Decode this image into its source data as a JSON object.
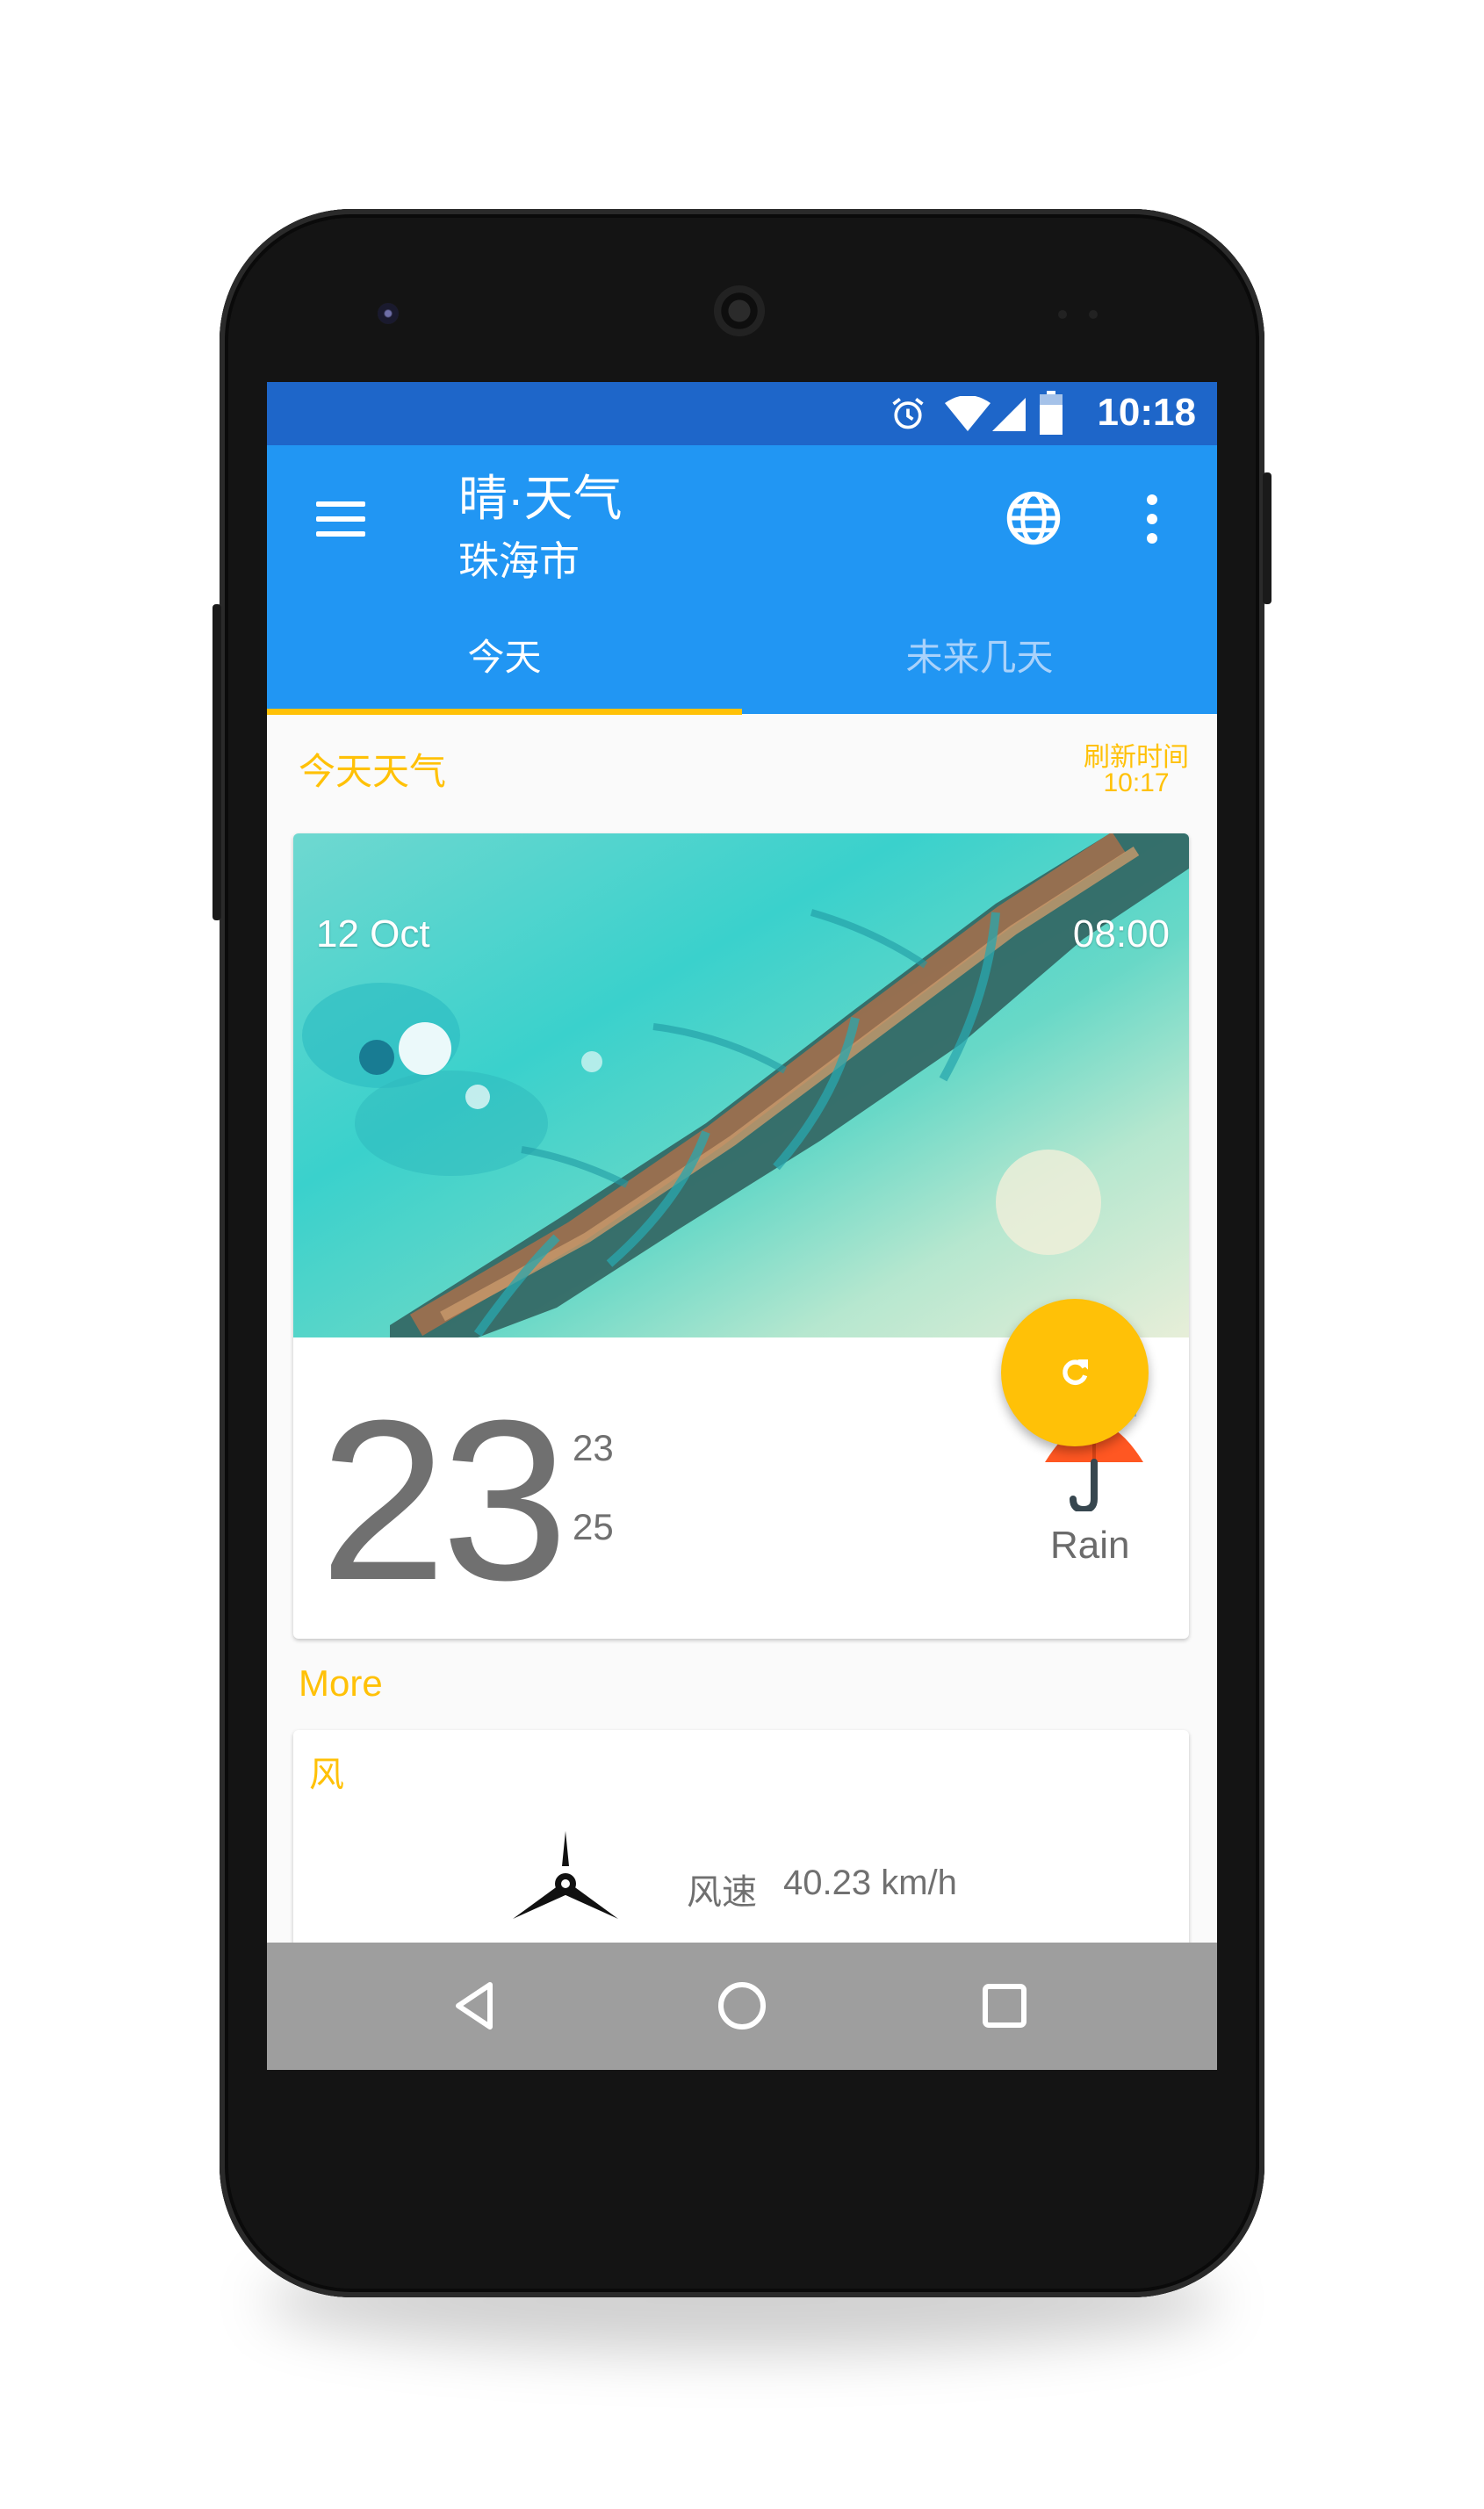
{
  "status_bar": {
    "time": "10:18",
    "icons": [
      "alarm-icon",
      "wifi-icon",
      "signal-icon",
      "battery-icon"
    ],
    "background": "#1e66c9"
  },
  "app_bar": {
    "title": "晴·天气",
    "subtitle": "珠海市",
    "background": "#2196f3",
    "icons": [
      "menu-icon",
      "globe-icon",
      "more-vert-icon"
    ]
  },
  "tabs": [
    {
      "label": "今天",
      "selected": true
    },
    {
      "label": "未来几天",
      "selected": false
    }
  ],
  "today_section": {
    "label": "今天天气",
    "refresh_label": "刷新时间",
    "refresh_time": "10:17"
  },
  "weather_card": {
    "date": "12 Oct",
    "time": "08:00",
    "temperature": "23",
    "temp_values": [
      "23",
      "25"
    ],
    "condition": "Rain",
    "condition_icon": "umbrella-rain-icon"
  },
  "more_section": {
    "label": "More",
    "wind_card": {
      "title": "风",
      "speed_label": "风速",
      "speed_value": "40.23 km/h",
      "icon": "wind-turbine-icon"
    }
  },
  "fab": {
    "icon": "refresh-icon",
    "color": "#ffc107"
  },
  "nav_bar": {
    "icons": [
      "back-icon",
      "home-icon",
      "recents-icon"
    ]
  },
  "accent_color": "#ffc107"
}
